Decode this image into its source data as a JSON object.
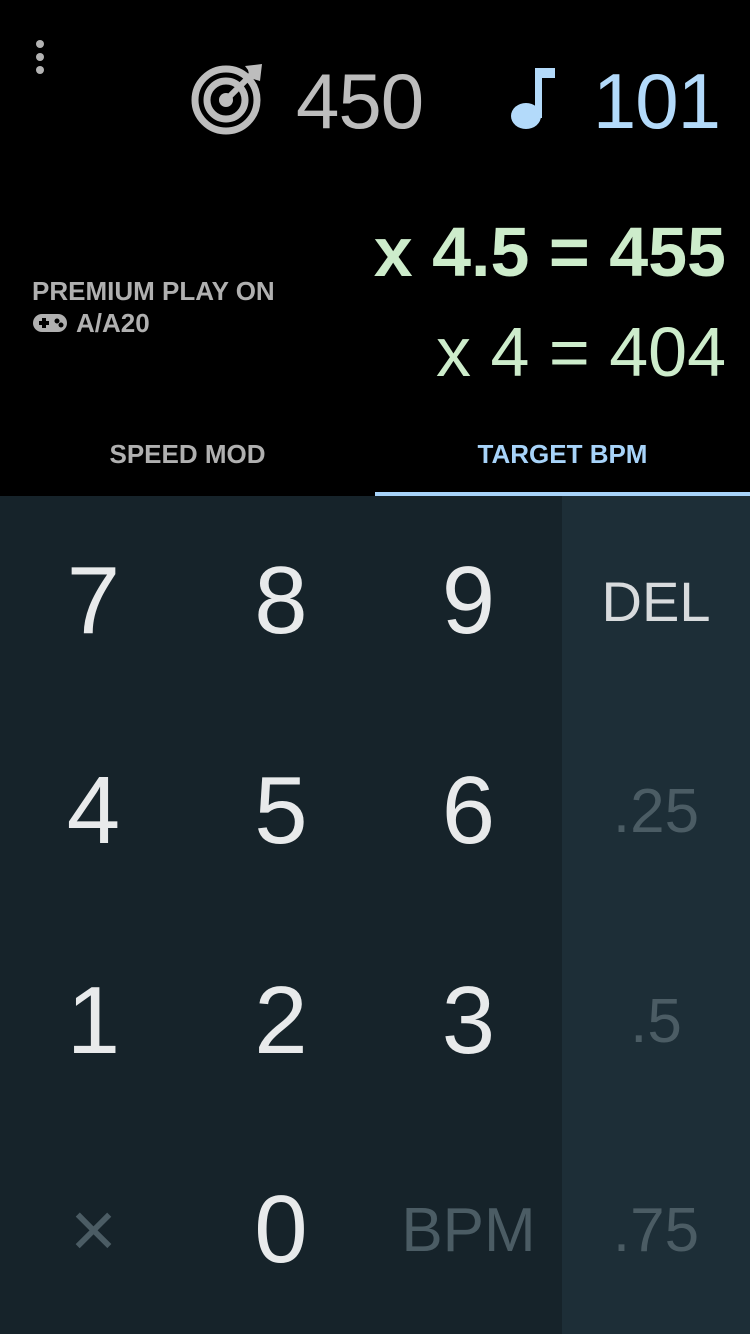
{
  "header": {
    "menu_icon": "more-vertical-icon",
    "target_icon": "target-icon",
    "target_value": "450",
    "note_icon": "music-note-icon",
    "bpm_value": "101",
    "result_primary": "x 4.5 = 455",
    "result_secondary": "x 4 = 404",
    "premium_line1": "PREMIUM PLAY ON",
    "premium_icon": "gamepad-icon",
    "premium_line2": "A/A20"
  },
  "tabs": [
    {
      "label": "SPEED MOD",
      "selected": false
    },
    {
      "label": "TARGET BPM",
      "selected": true
    }
  ],
  "keypad": {
    "keys": [
      "7",
      "8",
      "9",
      "4",
      "5",
      "6",
      "1",
      "2",
      "3",
      "×",
      "0",
      "BPM"
    ]
  },
  "side_keys": [
    "DEL",
    ".25",
    ".5",
    ".75"
  ],
  "colors": {
    "background": "#000000",
    "keypad_bg": "#16232a",
    "side_bg": "#1d2e37",
    "accent_blue": "#a7d3f9",
    "result_green": "#cdeccb"
  }
}
